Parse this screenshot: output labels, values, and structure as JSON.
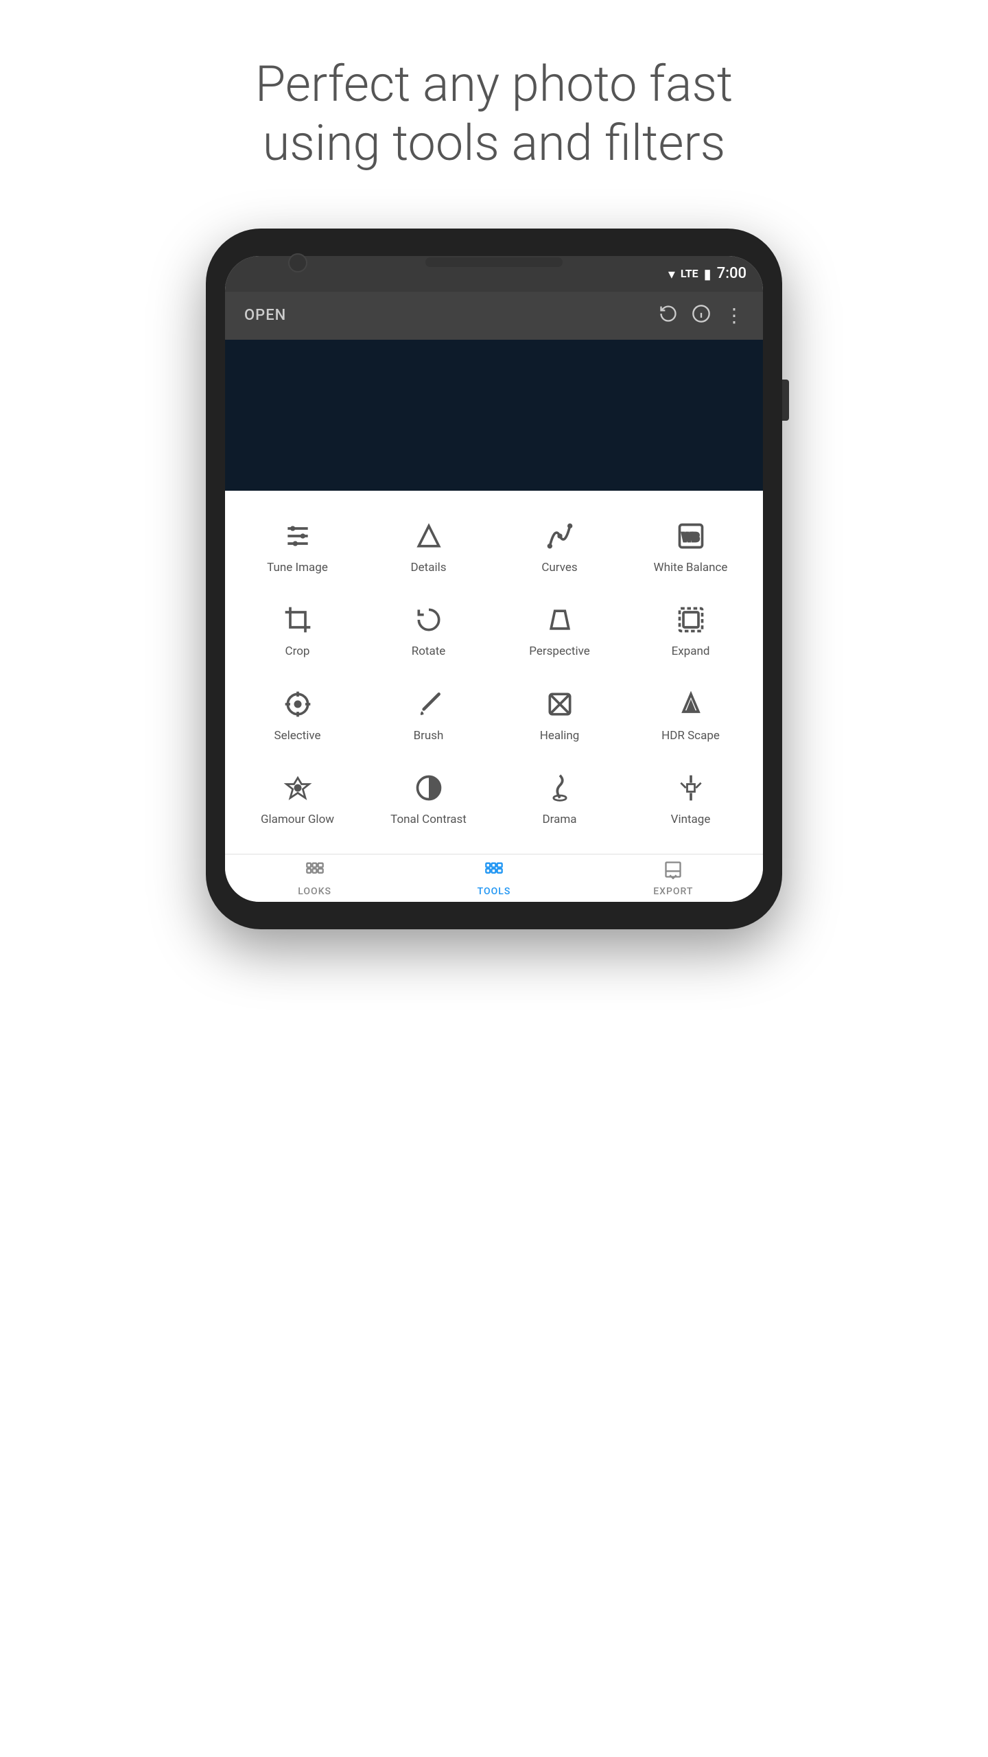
{
  "page": {
    "title_line1": "Perfect any photo fast",
    "title_line2": "using tools and filters"
  },
  "status_bar": {
    "time": "7:00"
  },
  "app_bar": {
    "open_label": "OPEN"
  },
  "tools": [
    {
      "id": "tune-image",
      "label": "Tune Image",
      "icon": "tune"
    },
    {
      "id": "details",
      "label": "Details",
      "icon": "details"
    },
    {
      "id": "curves",
      "label": "Curves",
      "icon": "curves"
    },
    {
      "id": "white-balance",
      "label": "White Balance",
      "icon": "wb"
    },
    {
      "id": "crop",
      "label": "Crop",
      "icon": "crop"
    },
    {
      "id": "rotate",
      "label": "Rotate",
      "icon": "rotate"
    },
    {
      "id": "perspective",
      "label": "Perspective",
      "icon": "perspective"
    },
    {
      "id": "expand",
      "label": "Expand",
      "icon": "expand"
    },
    {
      "id": "selective",
      "label": "Selective",
      "icon": "selective"
    },
    {
      "id": "brush",
      "label": "Brush",
      "icon": "brush"
    },
    {
      "id": "healing",
      "label": "Healing",
      "icon": "healing"
    },
    {
      "id": "hdr-scape",
      "label": "HDR Scape",
      "icon": "hdr"
    },
    {
      "id": "glamour-glow",
      "label": "Glamour Glow",
      "icon": "glamour"
    },
    {
      "id": "tonal-contrast",
      "label": "Tonal Contrast",
      "icon": "tonal"
    },
    {
      "id": "drama",
      "label": "Drama",
      "icon": "drama"
    },
    {
      "id": "vintage",
      "label": "Vintage",
      "icon": "vintage"
    }
  ],
  "bottom_nav": [
    {
      "id": "looks",
      "label": "LOOKS",
      "active": false
    },
    {
      "id": "tools",
      "label": "TOOLS",
      "active": true
    },
    {
      "id": "export",
      "label": "EXPORT",
      "active": false
    }
  ]
}
